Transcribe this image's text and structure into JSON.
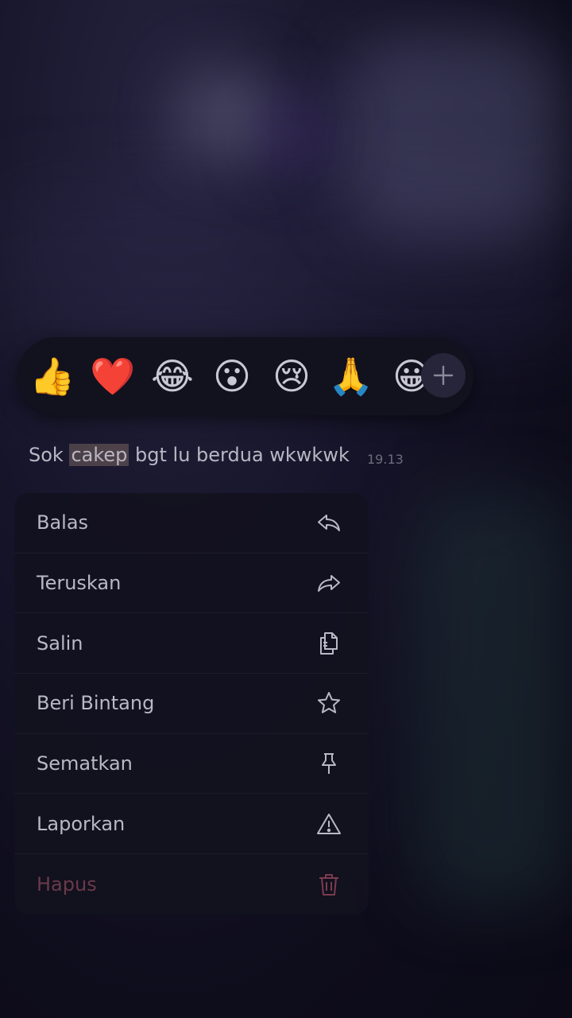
{
  "reactions": {
    "items": [
      {
        "name": "thumbs-up",
        "glyph": "👍"
      },
      {
        "name": "red-heart",
        "glyph": "❤️"
      },
      {
        "name": "tears-of-joy",
        "glyph": "😂"
      },
      {
        "name": "surprised-face",
        "glyph": "😮"
      },
      {
        "name": "crying-face",
        "glyph": "😢"
      },
      {
        "name": "folded-hands",
        "glyph": "🙏"
      },
      {
        "name": "partial-emoji",
        "glyph": "😀"
      }
    ],
    "add_icon": "plus-icon"
  },
  "message": {
    "text_before": "Sok ",
    "highlighted": "cakep",
    "text_after": " bgt lu berdua wkwkwk",
    "time": "19.13"
  },
  "menu": {
    "items": [
      {
        "label": "Balas",
        "icon": "reply-icon"
      },
      {
        "label": "Teruskan",
        "icon": "forward-icon"
      },
      {
        "label": "Salin",
        "icon": "copy-icon"
      },
      {
        "label": "Beri Bintang",
        "icon": "star-icon"
      },
      {
        "label": "Sematkan",
        "icon": "pin-icon"
      },
      {
        "label": "Laporkan",
        "icon": "warning-icon"
      },
      {
        "label": "Hapus",
        "icon": "trash-icon"
      }
    ]
  },
  "colors": {
    "background": "#0d0c1a",
    "menu_bg": "#12111e",
    "text": "#b9b8c4",
    "danger": "#6a3a4a",
    "highlight": "#d2aa8c"
  }
}
